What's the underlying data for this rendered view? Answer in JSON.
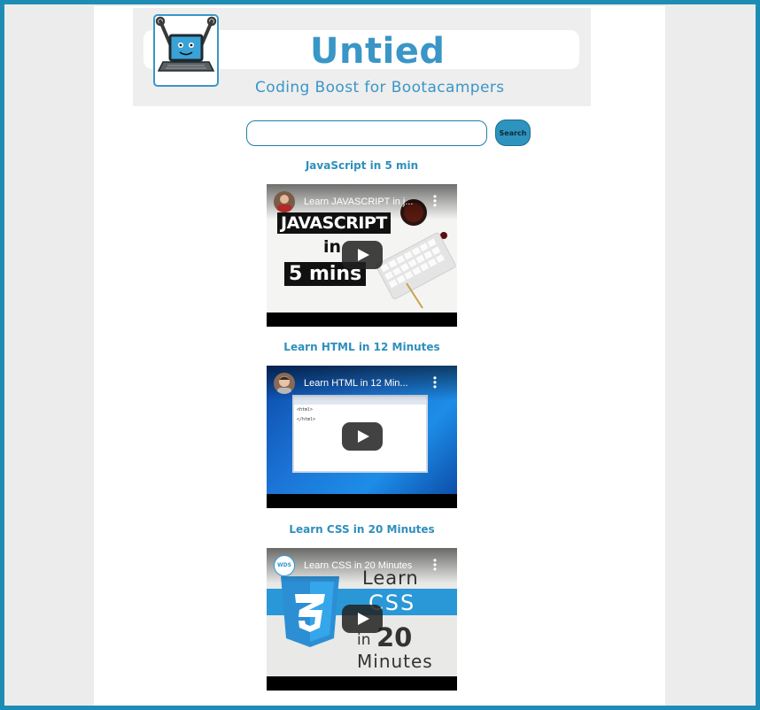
{
  "header": {
    "brand": "Untied",
    "tagline": "Coding Boost for Bootacampers",
    "logo_icon": "laptop-robot-icon"
  },
  "search": {
    "value": "",
    "placeholder": "",
    "button_label": "Search"
  },
  "videos": [
    {
      "title": "JavaScript in 5 min",
      "player_title": "Learn JAVASCRIPT in j...",
      "thumb_text_1": "JAVASCRIPT",
      "thumb_text_2": "in",
      "thumb_text_3": "5 mins"
    },
    {
      "title": "Learn HTML in 12 Minutes",
      "player_title": "Learn HTML in 12 Min...",
      "thumb_text_1": "<html>",
      "thumb_text_2": "</html>"
    },
    {
      "title": "Learn CSS in 20 Minutes",
      "player_title": "Learn CSS in 20 Minutes",
      "thumb_text_1": "Learn",
      "thumb_text_2": "CSS",
      "thumb_text_3": "in",
      "thumb_text_4": "20",
      "thumb_text_5": "Minutes",
      "badge": "WDS"
    }
  ],
  "colors": {
    "accent": "#2e8fbd",
    "frame": "#1e8db5",
    "button": "#2e93be"
  }
}
